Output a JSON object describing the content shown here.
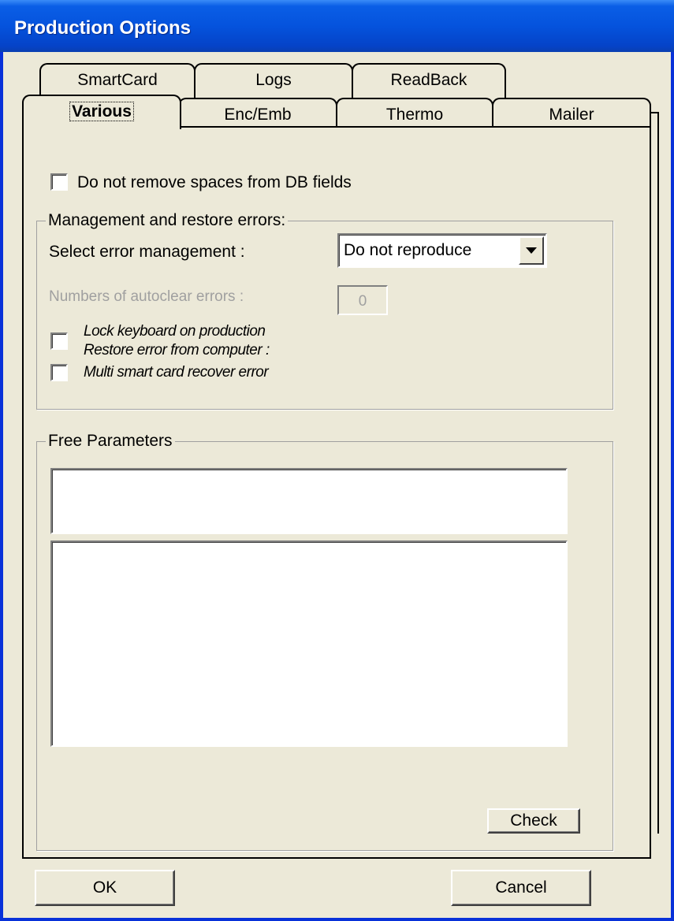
{
  "window": {
    "title": "Production Options"
  },
  "tabs": {
    "back_row": [
      "SmartCard",
      "Logs",
      "ReadBack"
    ],
    "front_row": [
      "Various",
      "Enc/Emb",
      "Thermo",
      "Mailer"
    ],
    "active": "Various"
  },
  "various": {
    "no_remove_spaces": {
      "label": "Do not remove spaces from DB fields",
      "checked": false
    },
    "errors_group": {
      "title": "Management and restore errors:",
      "select_label": "Select error management :",
      "select_value": "Do not reproduce",
      "autoclear_label": "Numbers of autoclear errors :",
      "autoclear_value": "0",
      "lock_keyboard_label": "Lock keyboard on production",
      "restore_error_label": "Restore error from computer :",
      "multi_smartcard_label": "Multi smart card recover error",
      "lock_keyboard_checked": false,
      "multi_smartcard_checked": false
    },
    "free_params": {
      "title": "Free Parameters",
      "header_value": "",
      "rows": [
        "",
        "",
        "",
        "",
        "",
        "",
        "",
        ""
      ],
      "check_button": "Check"
    }
  },
  "footer": {
    "ok_button": "OK",
    "cancel_button": "Cancel"
  }
}
